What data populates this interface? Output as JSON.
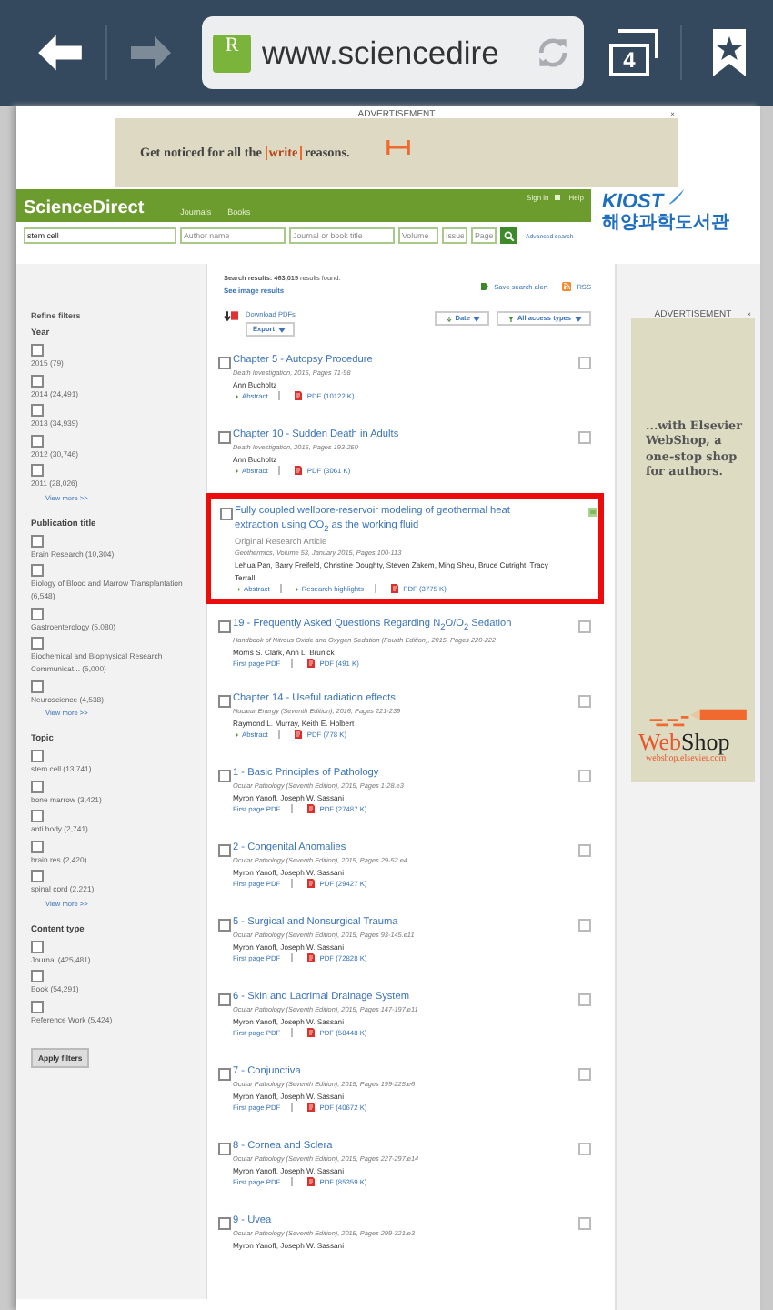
{
  "browser": {
    "site_badge": "R",
    "url": "www.sciencedire",
    "tab_count": "4"
  },
  "top_ad": {
    "label": "ADVERTISEMENT",
    "close": "×",
    "text_start": "Get noticed for all the",
    "struck_word": "write",
    "text_end": "reasons."
  },
  "header": {
    "logo": "ScienceDirect",
    "nav": [
      "Journals",
      "Books"
    ],
    "sign_in": "Sign in",
    "help": "Help",
    "partner_logo": "KIOST",
    "partner_name": "해양과학도서관"
  },
  "search": {
    "fields": [
      {
        "value": "stem cell"
      },
      {
        "placeholder": "Author name"
      },
      {
        "placeholder": "Journal or book title"
      },
      {
        "placeholder": "Volume"
      },
      {
        "placeholder": "Issue"
      },
      {
        "placeholder": "Page"
      }
    ],
    "advanced": "Advanced search"
  },
  "sidebar": {
    "title": "Refine filters",
    "groups": [
      {
        "title": "Year",
        "items": [
          {
            "label": "2015 (79)",
            "checked": false
          },
          {
            "label": "2014 (24,491)",
            "checked": false
          },
          {
            "label": "2013 (34,939)",
            "checked": false
          },
          {
            "label": "2012 (30,746)",
            "checked": false
          },
          {
            "label": "2011 (28,026)",
            "checked": false
          }
        ],
        "more": "View more >>"
      },
      {
        "title": "Publication title",
        "items": [
          {
            "label": "Brain Research (10,304)",
            "checked": false
          },
          {
            "label": "Biology of Blood and Marrow Transplantation (6,548)",
            "checked": false
          },
          {
            "label": "Gastroenterology (5,080)",
            "checked": false
          },
          {
            "label": "Biochemical and Biophysical Research Communicat... (5,000)",
            "checked": false
          },
          {
            "label": "Neuroscience (4,538)",
            "checked": false
          }
        ],
        "more": "View more >>"
      },
      {
        "title": "Topic",
        "items": [
          {
            "label": "stem cell (13,741)",
            "checked": false
          },
          {
            "label": "bone marrow (3,421)",
            "checked": false
          },
          {
            "label": "anti body (2,741)",
            "checked": false
          },
          {
            "label": "brain res (2,420)",
            "checked": false
          },
          {
            "label": "spinal cord (2,221)",
            "checked": false
          }
        ],
        "more": "View more >>"
      },
      {
        "title": "Content type",
        "items": [
          {
            "label": "Journal (425,481)",
            "checked": false
          },
          {
            "label": "Book (54,291)",
            "checked": false
          },
          {
            "label": "Reference Work (5,424)",
            "checked": false
          }
        ]
      }
    ],
    "apply": "Apply filters"
  },
  "results_header": {
    "summary": "**Search results: 463,015** results found.",
    "image_results": "See image results",
    "save_alert": "Save search alert",
    "rss": "RSS"
  },
  "toolbar": {
    "download": "Download PDFs",
    "export": "Export",
    "sort": "Date",
    "access": "All access types"
  },
  "results": [
    {
      "title": "Chapter 5 - Autopsy Procedure",
      "source": "Death Investigation, 2015, Pages 71-98",
      "authors": "Ann Bucholtz",
      "links": [
        {
          "kind": "abstract",
          "label": "Abstract"
        },
        {
          "kind": "pdf",
          "label": "PDF (10122 K)"
        }
      ],
      "checked": false,
      "highlighted": false,
      "kind": "checkbox"
    },
    {
      "title": "Chapter 10 - Sudden Death in Adults",
      "source": "Death Investigation, 2015, Pages 193-250",
      "authors": "Ann Bucholtz",
      "links": [
        {
          "kind": "abstract",
          "label": "Abstract"
        },
        {
          "kind": "pdf",
          "label": "PDF (3061 K)"
        }
      ],
      "checked": false,
      "highlighted": false,
      "kind": "checkbox"
    },
    {
      "title": "Fully coupled wellbore-reservoir modeling of geothermal heat extraction using CO$_{2}$ as the working fluid",
      "type": "Original Research Article",
      "source": "Geothermics, Volume 53, January 2015, Pages 100-113",
      "authors": "Lehua Pan, Barry Freifeld, Christine Doughty, Steven Zakem, Ming Sheu, Bruce Cutright, Tracy Terrall",
      "links": [
        {
          "kind": "abstract",
          "label": "Abstract"
        },
        {
          "kind": "abstract",
          "label": "Research highlights"
        },
        {
          "kind": "pdf",
          "label": "PDF (3775 K)"
        }
      ],
      "checked": false,
      "highlighted": true,
      "kind": "preview"
    },
    {
      "title": "19 - Frequently Asked Questions Regarding N$_{2}$O/O$_{2}$ Sedation",
      "source": "Handbook of Nitrous Oxide and Oxygen Sedation (Fourth Edition), 2015, Pages 220-222",
      "authors": "Morris S. Clark, Ann L. Brunick",
      "links": [
        {
          "kind": "plain",
          "label": "First page PDF"
        },
        {
          "kind": "pdf",
          "label": "PDF (491 K)"
        }
      ],
      "checked": false,
      "highlighted": false,
      "kind": "checkbox"
    },
    {
      "title": "Chapter 14 - Useful radiation effects",
      "source": "Nuclear Energy (Seventh Edition), 2016, Pages 221-239",
      "authors": "Raymond L. Murray, Keith E. Holbert",
      "links": [
        {
          "kind": "abstract",
          "label": "Abstract"
        },
        {
          "kind": "pdf",
          "label": "PDF (778 K)"
        }
      ],
      "checked": false,
      "highlighted": false,
      "kind": "checkbox"
    },
    {
      "title": "1 - Basic Principles of Pathology",
      "source": "Ocular Pathology (Seventh Edition), 2015, Pages 1-28.e3",
      "authors": "Myron Yanoff, Joseph W. Sassani",
      "links": [
        {
          "kind": "plain",
          "label": "First page PDF"
        },
        {
          "kind": "pdf",
          "label": "PDF (27487 K)"
        }
      ],
      "checked": false,
      "highlighted": false,
      "kind": "checkbox"
    },
    {
      "title": "2 - Congenital Anomalies",
      "source": "Ocular Pathology (Seventh Edition), 2015, Pages 29-52.e4",
      "authors": "Myron Yanoff, Joseph W. Sassani",
      "links": [
        {
          "kind": "plain",
          "label": "First page PDF"
        },
        {
          "kind": "pdf",
          "label": "PDF (29427 K)"
        }
      ],
      "checked": false,
      "highlighted": false,
      "kind": "checkbox"
    },
    {
      "title": "5 - Surgical and Nonsurgical Trauma",
      "source": "Ocular Pathology (Seventh Edition), 2015, Pages 93-145.e11",
      "authors": "Myron Yanoff, Joseph W. Sassani",
      "links": [
        {
          "kind": "plain",
          "label": "First page PDF"
        },
        {
          "kind": "pdf",
          "label": "PDF (72828 K)"
        }
      ],
      "checked": false,
      "highlighted": false,
      "kind": "checkbox"
    },
    {
      "title": "6 - Skin and Lacrimal Drainage System",
      "source": "Ocular Pathology (Seventh Edition), 2015, Pages 147-197.e11",
      "authors": "Myron Yanoff, Joseph W. Sassani",
      "links": [
        {
          "kind": "plain",
          "label": "First page PDF"
        },
        {
          "kind": "pdf",
          "label": "PDF (58448 K)"
        }
      ],
      "checked": false,
      "highlighted": false,
      "kind": "checkbox"
    },
    {
      "title": "7 - Conjunctiva",
      "source": "Ocular Pathology (Seventh Edition), 2015, Pages 199-225.e6",
      "authors": "Myron Yanoff, Joseph W. Sassani",
      "links": [
        {
          "kind": "plain",
          "label": "First page PDF"
        },
        {
          "kind": "pdf",
          "label": "PDF (40672 K)"
        }
      ],
      "checked": false,
      "highlighted": false,
      "kind": "checkbox"
    },
    {
      "title": "8 - Cornea and Sclera",
      "source": "Ocular Pathology (Seventh Edition), 2015, Pages 227-297.e14",
      "authors": "Myron Yanoff, Joseph W. Sassani",
      "links": [
        {
          "kind": "plain",
          "label": "First page PDF"
        },
        {
          "kind": "pdf",
          "label": "PDF (85359 K)"
        }
      ],
      "checked": false,
      "highlighted": false,
      "kind": "checkbox"
    },
    {
      "title": "9 - Uvea",
      "source": "Ocular Pathology (Seventh Edition), 2015, Pages 299-321.e3",
      "authors": "Myron Yanoff, Joseph W. Sassani",
      "checked": false,
      "highlighted": false,
      "kind": "checkbox"
    }
  ],
  "side_ad": {
    "label": "ADVERTISEMENT",
    "close": "×",
    "text": "...with Elsevier WebShop, a one-stop shop for authors.",
    "logo_a": "Web",
    "logo_b": "Shop",
    "site": "webshop.elsevier.com"
  }
}
